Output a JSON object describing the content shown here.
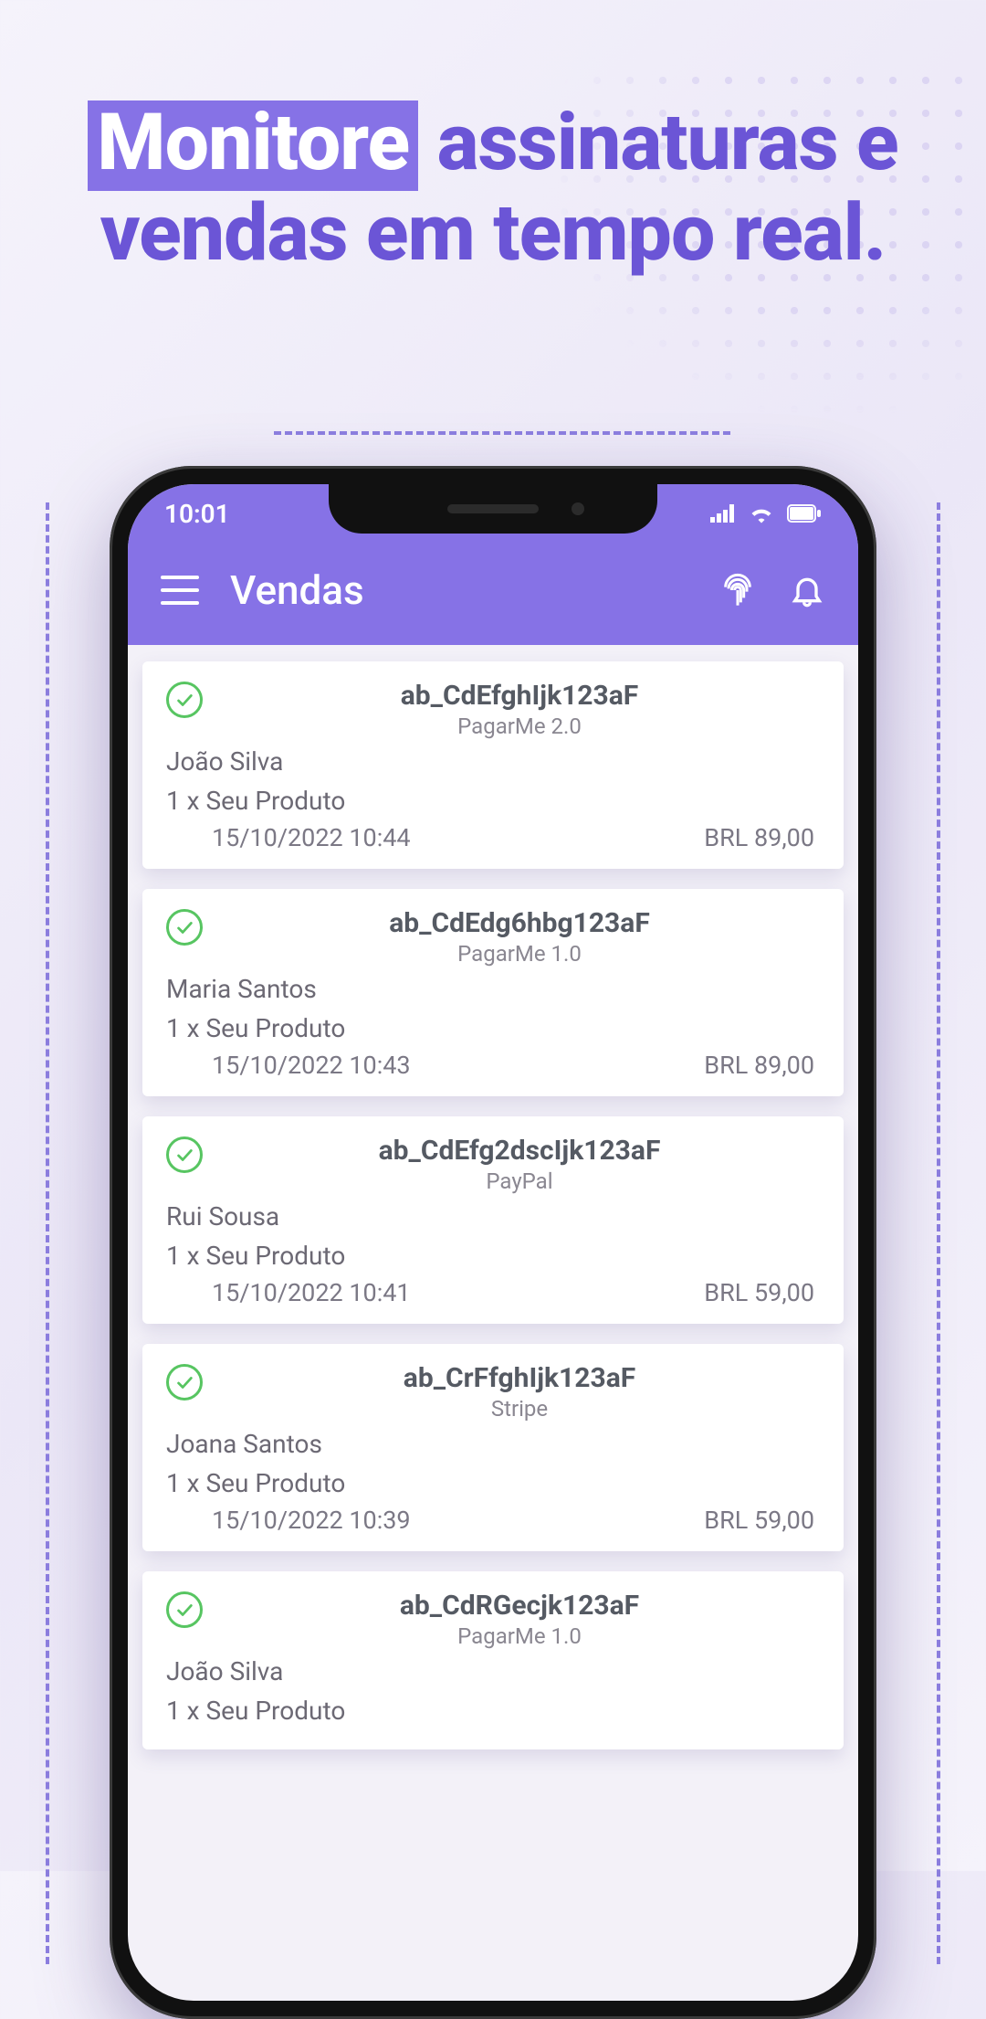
{
  "headline": {
    "highlight": "Monitore",
    "rest1": "assinaturas e",
    "line2": "vendas em tempo real."
  },
  "statusbar": {
    "time": "10:01"
  },
  "header": {
    "title": "Vendas"
  },
  "sales": [
    {
      "txid": "ab_CdEfghIjk123aF",
      "gateway": "PagarMe 2.0",
      "customer": "João Silva",
      "product": "1 x Seu Produto",
      "datetime": "15/10/2022 10:44",
      "amount": "BRL 89,00"
    },
    {
      "txid": "ab_CdEdg6hbg123aF",
      "gateway": "PagarMe 1.0",
      "customer": "Maria Santos",
      "product": "1 x Seu Produto",
      "datetime": "15/10/2022 10:43",
      "amount": "BRL 89,00"
    },
    {
      "txid": "ab_CdEfg2dscIjk123aF",
      "gateway": "PayPal",
      "customer": "Rui Sousa",
      "product": "1 x Seu Produto",
      "datetime": "15/10/2022 10:41",
      "amount": "BRL 59,00"
    },
    {
      "txid": "ab_CrFfghIjk123aF",
      "gateway": "Stripe",
      "customer": "Joana Santos",
      "product": "1 x Seu Produto",
      "datetime": "15/10/2022 10:39",
      "amount": "BRL 59,00"
    },
    {
      "txid": "ab_CdRGecjk123aF",
      "gateway": "PagarMe 1.0",
      "customer": "João Silva",
      "product": "1 x Seu Produto",
      "datetime": "",
      "amount": ""
    }
  ]
}
